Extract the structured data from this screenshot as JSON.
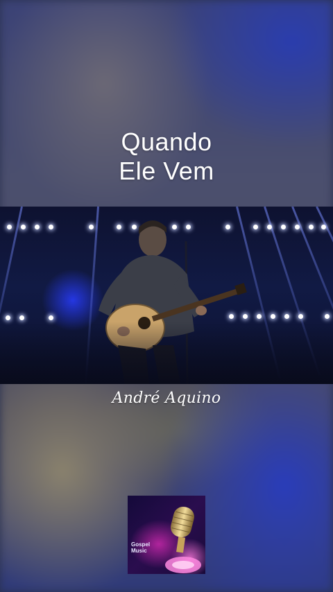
{
  "song": {
    "title_line1": "Quando",
    "title_line2": "Ele Vem"
  },
  "artist": {
    "name": "André Aquino"
  },
  "logo": {
    "line1": "Gospel",
    "line2": "Music",
    "icon": "microphone-icon"
  },
  "colors": {
    "stage_blue": "#1e32dc",
    "logo_pink": "#ff78dc",
    "text": "#ffffff"
  }
}
